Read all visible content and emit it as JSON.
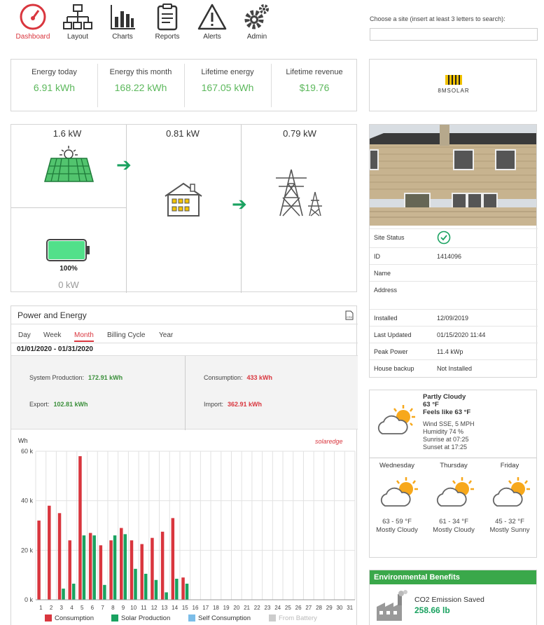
{
  "nav": [
    {
      "label": "Dashboard",
      "icon": "gauge-icon",
      "active": true
    },
    {
      "label": "Layout",
      "icon": "layout-tree-icon"
    },
    {
      "label": "Charts",
      "icon": "bar-chart-icon"
    },
    {
      "label": "Reports",
      "icon": "clipboard-icon"
    },
    {
      "label": "Alerts",
      "icon": "warning-icon"
    },
    {
      "label": "Admin",
      "icon": "gears-icon"
    }
  ],
  "site_search": {
    "label": "Choose a site (insert at least 3 letters to search):",
    "value": ""
  },
  "kpis": [
    {
      "label": "Energy today",
      "value": "6.91 kWh"
    },
    {
      "label": "Energy this month",
      "value": "168.22 kWh"
    },
    {
      "label": "Lifetime energy",
      "value": "167.05 kWh"
    },
    {
      "label": "Lifetime revenue",
      "value": "$19.76"
    }
  ],
  "logo_text": "8MSOLAR",
  "flow": {
    "solar": "1.6 kW",
    "home": "0.81 kW",
    "grid": "0.79 kW",
    "battery_percent": "100%",
    "battery_power": "0 kW",
    "battery_level": 1.0
  },
  "site_info": [
    {
      "key": "Site Status",
      "value": ""
    },
    {
      "key": "ID",
      "value": "1414096"
    },
    {
      "key": "Name",
      "value": ""
    },
    {
      "key": "Address",
      "value": ""
    },
    {
      "key": "Installed",
      "value": "12/09/2019"
    },
    {
      "key": "Last Updated",
      "value": "01/15/2020 11:44"
    },
    {
      "key": "Peak Power",
      "value": "11.4 kWp"
    },
    {
      "key": "House backup",
      "value": "Not Installed"
    }
  ],
  "power_energy": {
    "title": "Power and Energy",
    "tabs": [
      "Day",
      "Week",
      "Month",
      "Billing Cycle",
      "Year"
    ],
    "active_tab": "Month",
    "date_range": "01/01/2020 - 01/31/2020",
    "system_production_label": "System Production:",
    "system_production": "172.91 kWh",
    "consumption_label": "Consumption:",
    "consumption": "433 kWh",
    "export_label": "Export:",
    "export": "102.81 kWh",
    "import_label": "Import:",
    "import": "362.91 kWh",
    "chart_brand": "solaredge"
  },
  "chart_data": {
    "type": "bar",
    "ylabel": "Wh",
    "ylim": [
      0,
      60000
    ],
    "y_ticks": [
      "0 k",
      "20 k",
      "40 k",
      "60 k"
    ],
    "categories": [
      "1",
      "2",
      "3",
      "4",
      "5",
      "6",
      "7",
      "8",
      "9",
      "10",
      "11",
      "12",
      "13",
      "14",
      "15",
      "16",
      "17",
      "18",
      "19",
      "20",
      "21",
      "22",
      "23",
      "24",
      "25",
      "26",
      "27",
      "28",
      "29",
      "30",
      "31"
    ],
    "series": [
      {
        "name": "Consumption",
        "color": "#d9363e",
        "values": [
          32000,
          38000,
          35000,
          24000,
          58000,
          27000,
          22000,
          24000,
          29000,
          24000,
          22500,
          25000,
          27500,
          33000,
          9000
        ]
      },
      {
        "name": "Solar Production",
        "color": "#1aa260",
        "values": [
          0,
          0,
          4500,
          6500,
          26000,
          26000,
          6000,
          26000,
          26500,
          12500,
          10500,
          8000,
          3000,
          8500,
          6500
        ]
      },
      {
        "name": "Self Consumption",
        "color": "#7cbde8",
        "values": []
      },
      {
        "name": "From Battery",
        "color": "#cccccc",
        "values": []
      }
    ],
    "legend": "bottom"
  },
  "weather": {
    "condition": "Partly Cloudy",
    "temp": "63 °F",
    "feels": "Feels like 63 °F",
    "wind": "Wind SSE, 5 MPH",
    "humidity": "Humidity 74 %",
    "sunrise": "Sunrise at 07:25",
    "sunset": "Sunset at 17:25",
    "forecast": [
      {
        "day": "Wednesday",
        "temp": "63 - 59 °F",
        "desc": "Mostly Cloudy"
      },
      {
        "day": "Thursday",
        "temp": "61 - 34 °F",
        "desc": "Mostly Cloudy"
      },
      {
        "day": "Friday",
        "temp": "45 - 32 °F",
        "desc": "Mostly Sunny"
      }
    ]
  },
  "env": {
    "title": "Environmental Benefits",
    "co2_label": "CO2 Emission Saved",
    "co2_value": "258.66 lb"
  },
  "colors": {
    "accent_red": "#d9363e",
    "green": "#1aa260",
    "kpi_green": "#5cb85c",
    "env_header": "#3aa84a"
  }
}
